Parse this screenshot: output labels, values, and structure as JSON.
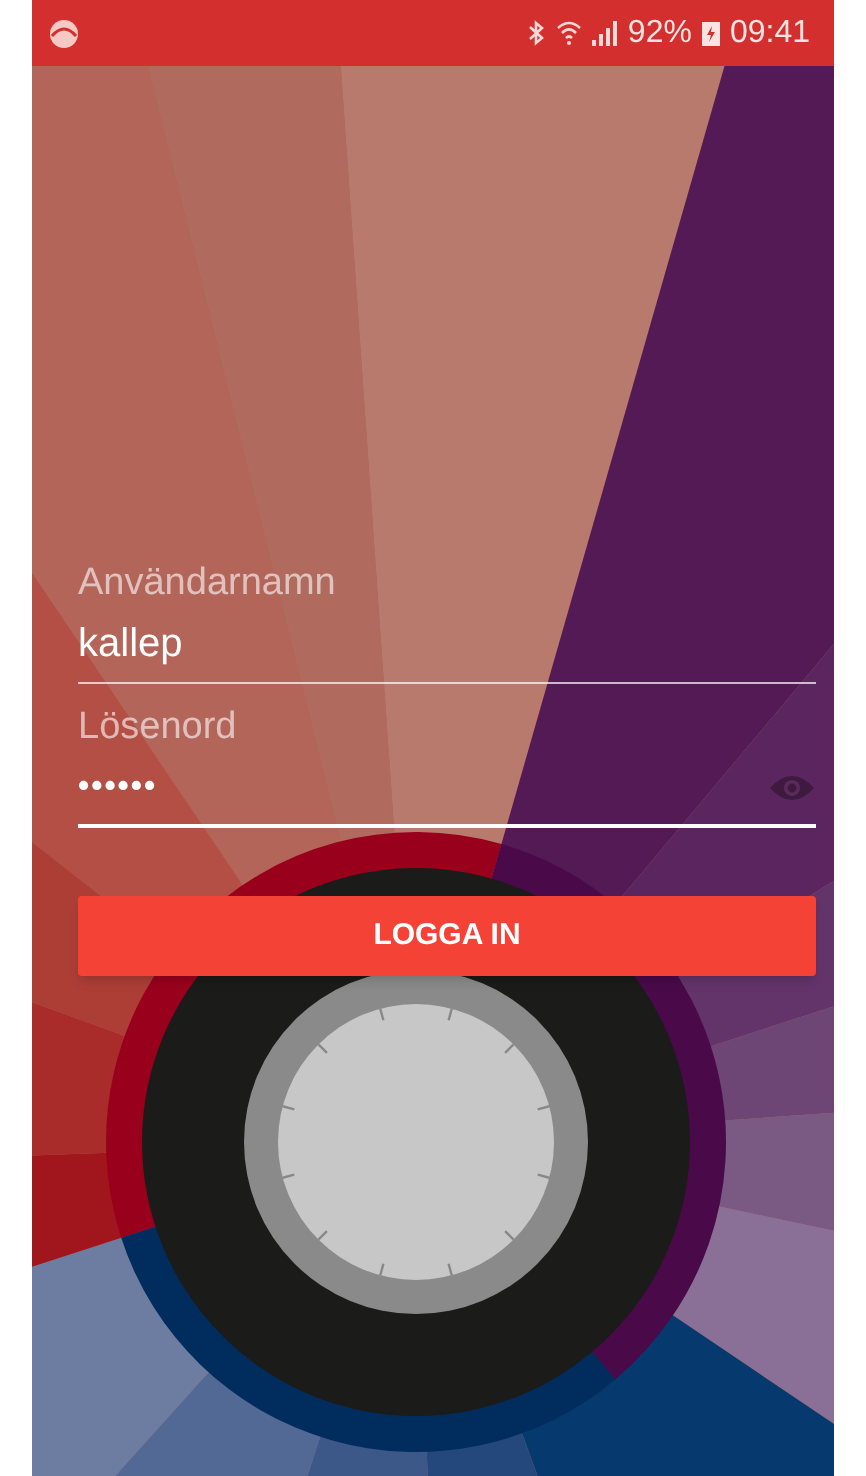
{
  "status_bar": {
    "battery": "92%",
    "time": "09:41"
  },
  "form": {
    "fields": [
      {
        "label": "Användarnamn",
        "value": "kallep",
        "focused": false,
        "kind": "text"
      },
      {
        "label": "Lösenord",
        "value": "••••••",
        "focused": true,
        "kind": "password"
      }
    ],
    "login_button": "LOGGA IN"
  }
}
